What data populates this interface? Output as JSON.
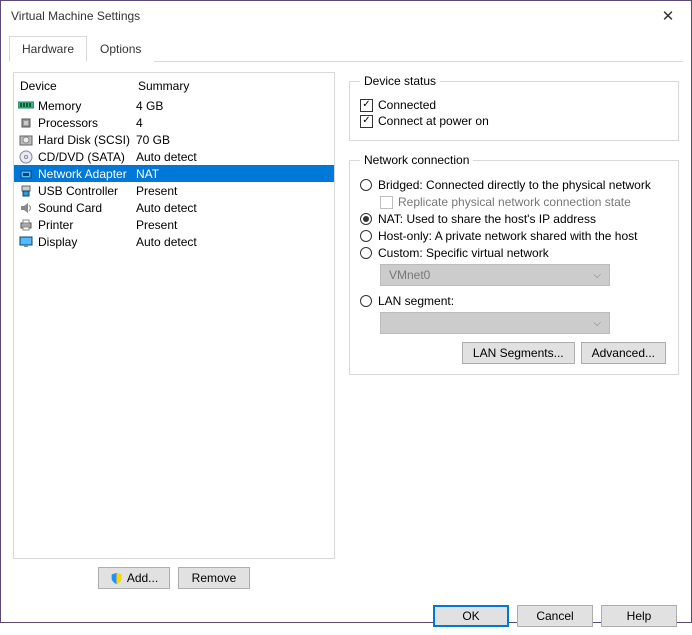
{
  "window": {
    "title": "Virtual Machine Settings"
  },
  "tabs": {
    "hardware": "Hardware",
    "options": "Options"
  },
  "headers": {
    "device": "Device",
    "summary": "Summary"
  },
  "devices": [
    {
      "name": "Memory",
      "summary": "4 GB",
      "icon": "memory"
    },
    {
      "name": "Processors",
      "summary": "4",
      "icon": "cpu"
    },
    {
      "name": "Hard Disk (SCSI)",
      "summary": "70 GB",
      "icon": "hdd"
    },
    {
      "name": "CD/DVD (SATA)",
      "summary": "Auto detect",
      "icon": "cd"
    },
    {
      "name": "Network Adapter",
      "summary": "NAT",
      "icon": "net",
      "selected": true
    },
    {
      "name": "USB Controller",
      "summary": "Present",
      "icon": "usb"
    },
    {
      "name": "Sound Card",
      "summary": "Auto detect",
      "icon": "sound"
    },
    {
      "name": "Printer",
      "summary": "Present",
      "icon": "printer"
    },
    {
      "name": "Display",
      "summary": "Auto detect",
      "icon": "display"
    }
  ],
  "buttons": {
    "add": "Add...",
    "remove": "Remove",
    "lan_segments": "LAN Segments...",
    "advanced": "Advanced...",
    "ok": "OK",
    "cancel": "Cancel",
    "help": "Help"
  },
  "device_status": {
    "legend": "Device status",
    "connected": "Connected",
    "connect_power": "Connect at power on"
  },
  "network": {
    "legend": "Network connection",
    "bridged": "Bridged: Connected directly to the physical network",
    "replicate": "Replicate physical network connection state",
    "nat": "NAT: Used to share the host's IP address",
    "hostonly": "Host-only: A private network shared with the host",
    "custom": "Custom: Specific virtual network",
    "custom_value": "VMnet0",
    "lan": "LAN segment:"
  }
}
